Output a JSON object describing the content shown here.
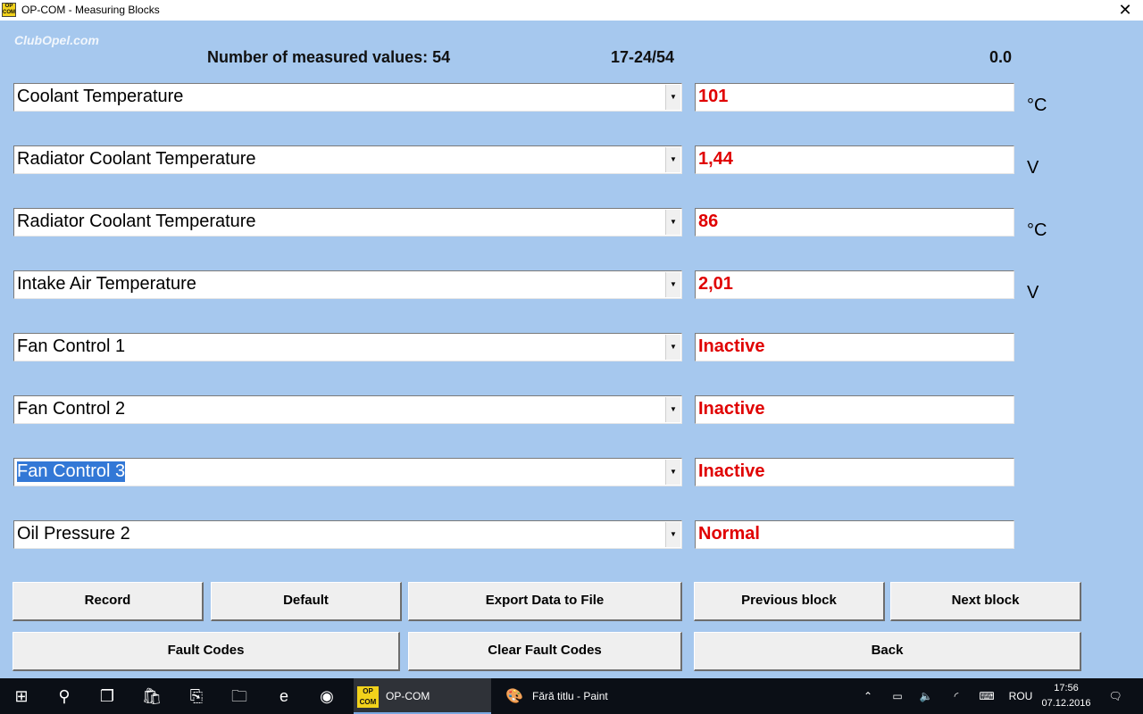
{
  "window": {
    "title": "OP-COM - Measuring Blocks",
    "icon_text": "OP COM",
    "close_glyph": "✕"
  },
  "watermark": "ClubOpel.com",
  "header": {
    "count_label": "Number of measured values: 54",
    "range": "17-24/54",
    "timer": "0.0"
  },
  "rows": [
    {
      "name": "Coolant Temperature",
      "value": "101",
      "unit": "°C"
    },
    {
      "name": "Radiator Coolant Temperature",
      "value": "1,44",
      "unit": "V"
    },
    {
      "name": "Radiator Coolant Temperature",
      "value": "86",
      "unit": "°C"
    },
    {
      "name": "Intake Air Temperature",
      "value": "2,01",
      "unit": "V"
    },
    {
      "name": "Fan Control 1",
      "value": "Inactive",
      "unit": ""
    },
    {
      "name": "Fan Control 2",
      "value": "Inactive",
      "unit": ""
    },
    {
      "name": "Fan Control 3",
      "value": "Inactive",
      "unit": ""
    },
    {
      "name": "Oil Pressure 2",
      "value": "Normal",
      "unit": ""
    }
  ],
  "selected_row": 6,
  "buttons": {
    "record": "Record",
    "default": "Default",
    "export": "Export Data to File",
    "previous": "Previous block",
    "next": "Next block",
    "fault_codes": "Fault Codes",
    "clear_fault_codes": "Clear Fault Codes",
    "back": "Back"
  },
  "taskbar": {
    "apps": [
      {
        "label": "OP-COM",
        "icon": "opcom-icon",
        "active": true
      },
      {
        "label": "Fără titlu - Paint",
        "icon": "paint-icon",
        "active": false
      }
    ],
    "language": "ROU",
    "time": "17:56",
    "date": "07.12.2016"
  },
  "colors": {
    "background": "#a6c8ee",
    "value_text": "#e00000",
    "selection": "#3378d6",
    "taskbar": "#0b0f16"
  }
}
